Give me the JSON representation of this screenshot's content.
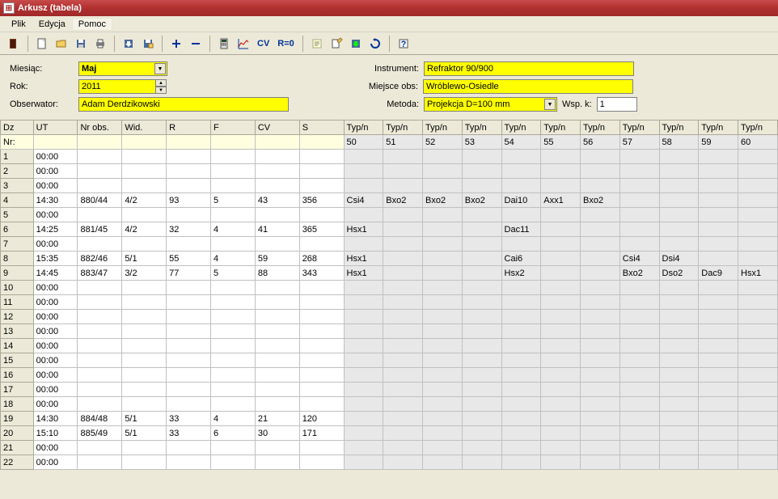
{
  "window": {
    "title": "Arkusz (tabela)"
  },
  "menu": {
    "items": [
      "Plik",
      "Edycja",
      "Pomoc"
    ]
  },
  "toolbar_text": {
    "cv": "CV",
    "r0": "R=0"
  },
  "form": {
    "labels": {
      "miesiac": "Miesiąc:",
      "rok": "Rok:",
      "obserwator": "Obserwator:",
      "instrument": "Instrument:",
      "miejsce": "Miejsce obs:",
      "metoda": "Metoda:",
      "wspk": "Wsp. k:"
    },
    "values": {
      "miesiac": "Maj",
      "rok": "2011",
      "obserwator": "Adam Derdzikowski",
      "instrument": "Refraktor 90/900",
      "miejsce": "Wróblewo-Osiedle",
      "metoda": "Projekcja D=100 mm",
      "wspk": "1"
    }
  },
  "grid": {
    "headers": [
      "Dz",
      "UT",
      "Nr obs.",
      "Wid.",
      "R",
      "F",
      "CV",
      "S",
      "Typ/n",
      "Typ/n",
      "Typ/n",
      "Typ/n",
      "Typ/n",
      "Typ/n",
      "Typ/n",
      "Typ/n",
      "Typ/n",
      "Typ/n",
      "Typ/n"
    ],
    "subhdr": [
      "Nr:",
      "",
      "",
      "",
      "",
      "",
      "",
      "",
      "50",
      "51",
      "52",
      "53",
      "54",
      "55",
      "56",
      "57",
      "58",
      "59",
      "60"
    ],
    "rows": [
      {
        "d": "1",
        "ut": "00:00",
        "nr": "",
        "wid": "",
        "r": "",
        "f": "",
        "cv": "",
        "s": "",
        "t": [
          "",
          "",
          "",
          "",
          "",
          "",
          "",
          "",
          "",
          "",
          ""
        ]
      },
      {
        "d": "2",
        "ut": "00:00",
        "nr": "",
        "wid": "",
        "r": "",
        "f": "",
        "cv": "",
        "s": "",
        "t": [
          "",
          "",
          "",
          "",
          "",
          "",
          "",
          "",
          "",
          "",
          ""
        ]
      },
      {
        "d": "3",
        "ut": "00:00",
        "nr": "",
        "wid": "",
        "r": "",
        "f": "",
        "cv": "",
        "s": "",
        "t": [
          "",
          "",
          "",
          "",
          "",
          "",
          "",
          "",
          "",
          "",
          ""
        ]
      },
      {
        "d": "4",
        "ut": "14:30",
        "nr": "880/44",
        "wid": "4/2",
        "r": "93",
        "f": "5",
        "cv": "43",
        "s": "356",
        "t": [
          "Csi4",
          "Bxo2",
          "Bxo2",
          "Bxo2",
          "Dai10",
          "Axx1",
          "Bxo2",
          "",
          "",
          "",
          ""
        ]
      },
      {
        "d": "5",
        "ut": "00:00",
        "nr": "",
        "wid": "",
        "r": "",
        "f": "",
        "cv": "",
        "s": "",
        "t": [
          "",
          "",
          "",
          "",
          "",
          "",
          "",
          "",
          "",
          "",
          ""
        ]
      },
      {
        "d": "6",
        "ut": "14:25",
        "nr": "881/45",
        "wid": "4/2",
        "r": "32",
        "f": "4",
        "cv": "41",
        "s": "365",
        "t": [
          "Hsx1",
          "",
          "",
          "",
          "Dac11",
          "",
          "",
          "",
          "",
          "",
          ""
        ]
      },
      {
        "d": "7",
        "ut": "00:00",
        "nr": "",
        "wid": "",
        "r": "",
        "f": "",
        "cv": "",
        "s": "",
        "t": [
          "",
          "",
          "",
          "",
          "",
          "",
          "",
          "",
          "",
          "",
          ""
        ]
      },
      {
        "d": "8",
        "ut": "15:35",
        "nr": "882/46",
        "wid": "5/1",
        "r": "55",
        "f": "4",
        "cv": "59",
        "s": "268",
        "t": [
          "Hsx1",
          "",
          "",
          "",
          "Cai6",
          "",
          "",
          "Csi4",
          "Dsi4",
          "",
          ""
        ]
      },
      {
        "d": "9",
        "ut": "14:45",
        "nr": "883/47",
        "wid": "3/2",
        "r": "77",
        "f": "5",
        "cv": "88",
        "s": "343",
        "t": [
          "Hsx1",
          "",
          "",
          "",
          "Hsx2",
          "",
          "",
          "Bxo2",
          "Dso2",
          "Dac9",
          "Hsx1"
        ]
      },
      {
        "d": "10",
        "ut": "00:00",
        "nr": "",
        "wid": "",
        "r": "",
        "f": "",
        "cv": "",
        "s": "",
        "t": [
          "",
          "",
          "",
          "",
          "",
          "",
          "",
          "",
          "",
          "",
          ""
        ]
      },
      {
        "d": "11",
        "ut": "00:00",
        "nr": "",
        "wid": "",
        "r": "",
        "f": "",
        "cv": "",
        "s": "",
        "t": [
          "",
          "",
          "",
          "",
          "",
          "",
          "",
          "",
          "",
          "",
          ""
        ]
      },
      {
        "d": "12",
        "ut": "00:00",
        "nr": "",
        "wid": "",
        "r": "",
        "f": "",
        "cv": "",
        "s": "",
        "t": [
          "",
          "",
          "",
          "",
          "",
          "",
          "",
          "",
          "",
          "",
          ""
        ]
      },
      {
        "d": "13",
        "ut": "00:00",
        "nr": "",
        "wid": "",
        "r": "",
        "f": "",
        "cv": "",
        "s": "",
        "t": [
          "",
          "",
          "",
          "",
          "",
          "",
          "",
          "",
          "",
          "",
          ""
        ]
      },
      {
        "d": "14",
        "ut": "00:00",
        "nr": "",
        "wid": "",
        "r": "",
        "f": "",
        "cv": "",
        "s": "",
        "t": [
          "",
          "",
          "",
          "",
          "",
          "",
          "",
          "",
          "",
          "",
          ""
        ]
      },
      {
        "d": "15",
        "ut": "00:00",
        "nr": "",
        "wid": "",
        "r": "",
        "f": "",
        "cv": "",
        "s": "",
        "t": [
          "",
          "",
          "",
          "",
          "",
          "",
          "",
          "",
          "",
          "",
          ""
        ]
      },
      {
        "d": "16",
        "ut": "00:00",
        "nr": "",
        "wid": "",
        "r": "",
        "f": "",
        "cv": "",
        "s": "",
        "t": [
          "",
          "",
          "",
          "",
          "",
          "",
          "",
          "",
          "",
          "",
          ""
        ]
      },
      {
        "d": "17",
        "ut": "00:00",
        "nr": "",
        "wid": "",
        "r": "",
        "f": "",
        "cv": "",
        "s": "",
        "t": [
          "",
          "",
          "",
          "",
          "",
          "",
          "",
          "",
          "",
          "",
          ""
        ]
      },
      {
        "d": "18",
        "ut": "00:00",
        "nr": "",
        "wid": "",
        "r": "",
        "f": "",
        "cv": "",
        "s": "",
        "t": [
          "",
          "",
          "",
          "",
          "",
          "",
          "",
          "",
          "",
          "",
          ""
        ]
      },
      {
        "d": "19",
        "ut": "14:30",
        "nr": "884/48",
        "wid": "5/1",
        "r": "33",
        "f": "4",
        "cv": "21",
        "s": "120",
        "t": [
          "",
          "",
          "",
          "",
          "",
          "",
          "",
          "",
          "",
          "",
          ""
        ]
      },
      {
        "d": "20",
        "ut": "15:10",
        "nr": "885/49",
        "wid": "5/1",
        "r": "33",
        "f": "6",
        "cv": "30",
        "s": "171",
        "t": [
          "",
          "",
          "",
          "",
          "",
          "",
          "",
          "",
          "",
          "",
          ""
        ]
      },
      {
        "d": "21",
        "ut": "00:00",
        "nr": "",
        "wid": "",
        "r": "",
        "f": "",
        "cv": "",
        "s": "",
        "t": [
          "",
          "",
          "",
          "",
          "",
          "",
          "",
          "",
          "",
          "",
          ""
        ]
      },
      {
        "d": "22",
        "ut": "00:00",
        "nr": "",
        "wid": "",
        "r": "",
        "f": "",
        "cv": "",
        "s": "",
        "t": [
          "",
          "",
          "",
          "",
          "",
          "",
          "",
          "",
          "",
          "",
          ""
        ]
      }
    ]
  }
}
